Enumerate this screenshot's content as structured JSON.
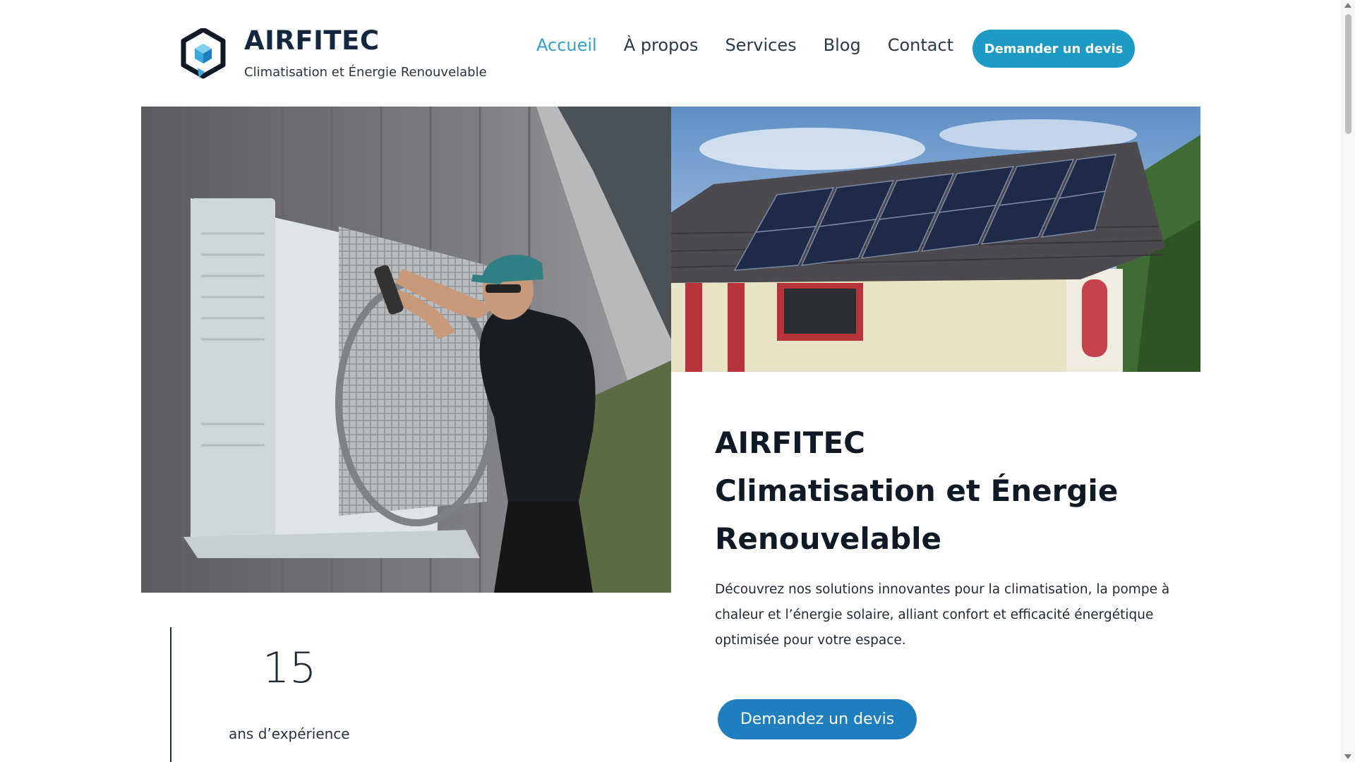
{
  "header": {
    "brand_name": "AIRFITEC",
    "tagline": "Climatisation et Énergie Renouvelable",
    "logo_icon": "cube-logo-icon",
    "nav": [
      {
        "label": "Accueil",
        "active": true
      },
      {
        "label": "À propos",
        "active": false
      },
      {
        "label": "Services",
        "active": false
      },
      {
        "label": "Blog",
        "active": false
      },
      {
        "label": "Contact",
        "active": false
      }
    ],
    "cta_label": "Demander un devis"
  },
  "hero": {
    "title_line1": "AIRFITEC",
    "title_line2": "Climatisation et Énergie Renouvelable",
    "description": "Découvrez nos solutions innovantes pour la climatisation, la pompe à chaleur et l’énergie solaire, alliant confort et efficacité énergétique optimisée pour votre espace.",
    "cta_label": "Demandez un devis"
  },
  "stats": {
    "years": "15",
    "years_label": "ans d’expérience"
  },
  "colors": {
    "accent": "#1d9bc4",
    "hero_button": "#1f7fbe",
    "nav_active": "#2ea3c8",
    "text_dark": "#0f1a26"
  }
}
